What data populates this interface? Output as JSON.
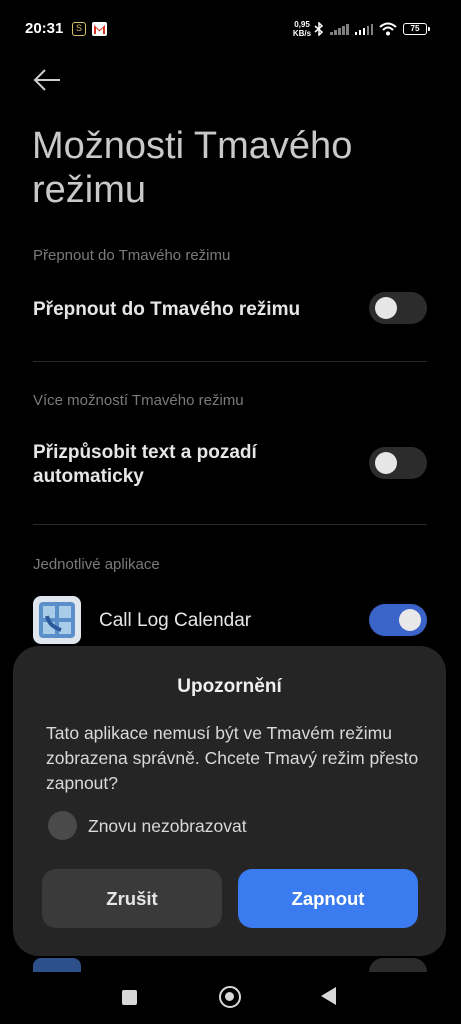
{
  "status": {
    "time": "20:31",
    "speed_value": "0,95",
    "speed_unit": "KB/s",
    "battery": "75"
  },
  "header": {
    "back_icon": "arrow-left-icon",
    "title": "Možnosti Tmavého režimu"
  },
  "sections": [
    {
      "label": "Přepnout do Tmavého režimu",
      "item_label": "Přepnout do Tmavého režimu",
      "enabled": false
    },
    {
      "label": "Více možností Tmavého režimu",
      "item_label": "Přizpůsobit text a pozadí automaticky",
      "enabled": false
    }
  ],
  "apps": {
    "label": "Jednotlivé aplikace",
    "items": [
      {
        "name": "Call Log Calendar",
        "enabled": true
      }
    ]
  },
  "dialog": {
    "title": "Upozornění",
    "message": "Tato aplikace nemusí být ve Tmavém režimu zobrazena správně. Chcete Tmavý režim přesto zapnout?",
    "checkbox_label": "Znovu nezobrazovat",
    "cancel_label": "Zrušit",
    "confirm_label": "Zapnout"
  },
  "colors": {
    "accent": "#3a7cef",
    "toggle_on": "#3b64c9",
    "background": "#000000",
    "dialog_bg": "#252525"
  }
}
